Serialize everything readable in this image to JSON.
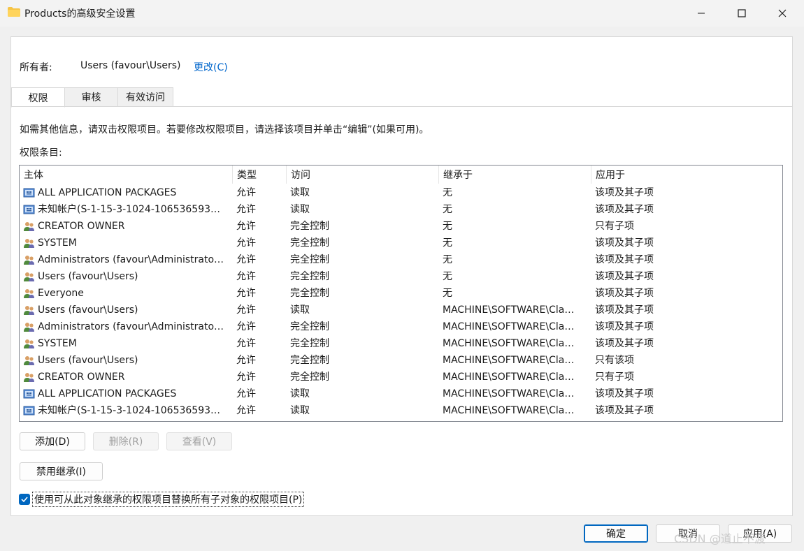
{
  "window": {
    "title": "Products的高级安全设置"
  },
  "owner": {
    "label": "所有者:",
    "value": "Users (favour\\Users)",
    "change": "更改(C)"
  },
  "tabs": [
    {
      "label": "权限"
    },
    {
      "label": "审核"
    },
    {
      "label": "有效访问"
    }
  ],
  "info_text": "如需其他信息，请双击权限项目。若要修改权限项目，请选择该项目并单击“编辑”(如果可用)。",
  "entries_label": "权限条目:",
  "columns": [
    "主体",
    "类型",
    "访问",
    "继承于",
    "应用于"
  ],
  "rows": [
    {
      "icon": "package-icon",
      "principal": "ALL APPLICATION PACKAGES",
      "type": "允许",
      "access": "读取",
      "inherited": "无",
      "applies": "该项及其子项"
    },
    {
      "icon": "package-icon",
      "principal": "未知帐户(S-1-15-3-1024-106536593…",
      "type": "允许",
      "access": "读取",
      "inherited": "无",
      "applies": "该项及其子项"
    },
    {
      "icon": "users-icon",
      "principal": "CREATOR OWNER",
      "type": "允许",
      "access": "完全控制",
      "inherited": "无",
      "applies": "只有子项"
    },
    {
      "icon": "users-icon",
      "principal": "SYSTEM",
      "type": "允许",
      "access": "完全控制",
      "inherited": "无",
      "applies": "该项及其子项"
    },
    {
      "icon": "users-icon",
      "principal": "Administrators (favour\\Administrato…",
      "type": "允许",
      "access": "完全控制",
      "inherited": "无",
      "applies": "该项及其子项"
    },
    {
      "icon": "users-icon",
      "principal": "Users (favour\\Users)",
      "type": "允许",
      "access": "完全控制",
      "inherited": "无",
      "applies": "该项及其子项"
    },
    {
      "icon": "users-icon",
      "principal": "Everyone",
      "type": "允许",
      "access": "完全控制",
      "inherited": "无",
      "applies": "该项及其子项"
    },
    {
      "icon": "users-icon",
      "principal": "Users (favour\\Users)",
      "type": "允许",
      "access": "读取",
      "inherited": "MACHINE\\SOFTWARE\\Cla…",
      "applies": "该项及其子项"
    },
    {
      "icon": "users-icon",
      "principal": "Administrators (favour\\Administrato…",
      "type": "允许",
      "access": "完全控制",
      "inherited": "MACHINE\\SOFTWARE\\Cla…",
      "applies": "该项及其子项"
    },
    {
      "icon": "users-icon",
      "principal": "SYSTEM",
      "type": "允许",
      "access": "完全控制",
      "inherited": "MACHINE\\SOFTWARE\\Cla…",
      "applies": "该项及其子项"
    },
    {
      "icon": "users-icon",
      "principal": "Users (favour\\Users)",
      "type": "允许",
      "access": "完全控制",
      "inherited": "MACHINE\\SOFTWARE\\Cla…",
      "applies": "只有该项"
    },
    {
      "icon": "users-icon",
      "principal": "CREATOR OWNER",
      "type": "允许",
      "access": "完全控制",
      "inherited": "MACHINE\\SOFTWARE\\Cla…",
      "applies": "只有子项"
    },
    {
      "icon": "package-icon",
      "principal": "ALL APPLICATION PACKAGES",
      "type": "允许",
      "access": "读取",
      "inherited": "MACHINE\\SOFTWARE\\Cla…",
      "applies": "该项及其子项"
    },
    {
      "icon": "package-icon",
      "principal": "未知帐户(S-1-15-3-1024-106536593…",
      "type": "允许",
      "access": "读取",
      "inherited": "MACHINE\\SOFTWARE\\Cla…",
      "applies": "该项及其子项"
    }
  ],
  "buttons": {
    "add": "添加(D)",
    "remove": "删除(R)",
    "view": "查看(V)",
    "disable_inheritance": "禁用继承(I)",
    "ok": "确定",
    "cancel": "取消",
    "apply": "应用(A)"
  },
  "replace_checkbox": {
    "label": "使用可从此对象继承的权限项目替换所有子对象的权限项目(P)",
    "checked": true
  },
  "watermark": "CSDN @道止不渡"
}
